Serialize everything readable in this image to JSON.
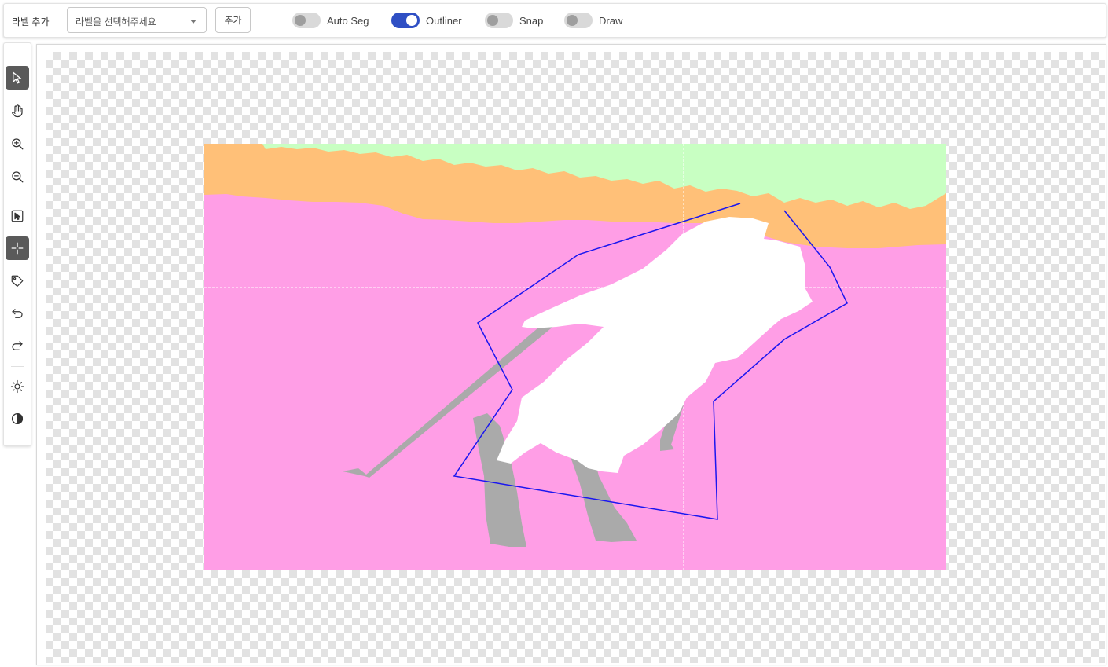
{
  "topbar": {
    "label_title": "라벨 추가",
    "select_placeholder": "라벨을 선택해주세요",
    "add_button": "추가",
    "toggles": [
      {
        "label": "Auto Seg",
        "on": false
      },
      {
        "label": "Outliner",
        "on": true
      },
      {
        "label": "Snap",
        "on": false
      },
      {
        "label": "Draw",
        "on": false
      }
    ]
  },
  "tools": [
    {
      "icon": "pointer-icon",
      "active": true
    },
    {
      "icon": "hand-icon",
      "active": false
    },
    {
      "icon": "zoom-in-icon",
      "active": false
    },
    {
      "icon": "zoom-out-icon",
      "active": false
    },
    {
      "icon": "select-box-icon",
      "active": false
    },
    {
      "icon": "crosshair-icon",
      "active": true
    },
    {
      "icon": "tag-icon",
      "active": false
    },
    {
      "icon": "undo-icon",
      "active": false
    },
    {
      "icon": "redo-icon",
      "active": false
    },
    {
      "icon": "brightness-icon",
      "active": false
    },
    {
      "icon": "contrast-icon",
      "active": false
    }
  ],
  "colors": {
    "accent": "#2f4fc4",
    "tool_active": "#5a5a5a",
    "seg_sky": "#c8ffc2",
    "seg_ground": "#ffc078",
    "seg_snow": "#ff9ee6",
    "seg_person": "#ffffff",
    "seg_skis": "#aaaaaa",
    "polygon": "#1a16f0"
  }
}
